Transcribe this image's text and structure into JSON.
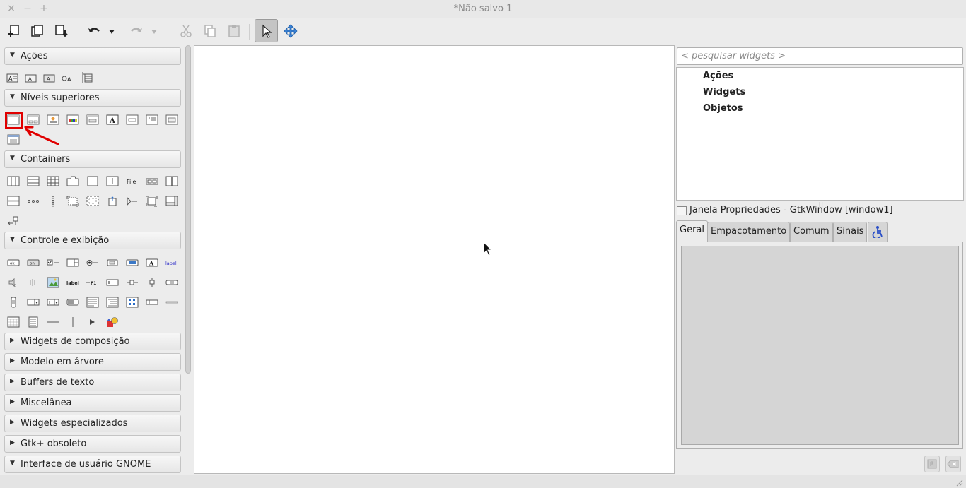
{
  "window": {
    "title": "*Não salvo 1",
    "controls": [
      "×",
      "−",
      "+"
    ]
  },
  "toolbar": {
    "buttons": [
      "new-icon",
      "open-icon",
      "save-icon",
      "undo-icon",
      "undo-menu-icon",
      "redo-icon",
      "redo-menu-icon",
      "cut-icon",
      "copy-icon",
      "paste-icon",
      "select-pointer-icon",
      "drag-resize-icon"
    ],
    "active": "select-pointer-icon"
  },
  "palette": {
    "groups": [
      {
        "label": "Ações",
        "expanded": true
      },
      {
        "label": "Níveis superiores",
        "expanded": true
      },
      {
        "label": "Containers",
        "expanded": true
      },
      {
        "label": "Controle e exibição",
        "expanded": true
      },
      {
        "label": "Widgets de composição",
        "expanded": false
      },
      {
        "label": "Modelo em árvore",
        "expanded": false
      },
      {
        "label": "Buffers de texto",
        "expanded": false
      },
      {
        "label": "Miscelânea",
        "expanded": false
      },
      {
        "label": "Widgets especializados",
        "expanded": false
      },
      {
        "label": "Gtk+ obsoleto",
        "expanded": false
      },
      {
        "label": "Interface de usuário GNOME",
        "expanded": true
      }
    ],
    "arrow_expanded": "▼",
    "arrow_collapsed": "▶",
    "widget_texts": {
      "file": "File",
      "label": "label",
      "label_blue": "label",
      "ok": "ok",
      "on": "on",
      "f1": "F1"
    },
    "highlighted_widget": "window-widget-icon"
  },
  "search": {
    "placeholder": "< pesquisar widgets >"
  },
  "inspector": {
    "nodes": [
      "Ações",
      "Widgets",
      "Objetos"
    ]
  },
  "properties": {
    "title": "Janela Propriedades - GtkWindow [window1]",
    "tabs": [
      "Geral",
      "Empacotamento",
      "Comum",
      "Sinais"
    ],
    "selected_tab": "Geral"
  },
  "colors": {
    "highlight": "#e00000",
    "accent_blue": "#2a6cc7"
  }
}
